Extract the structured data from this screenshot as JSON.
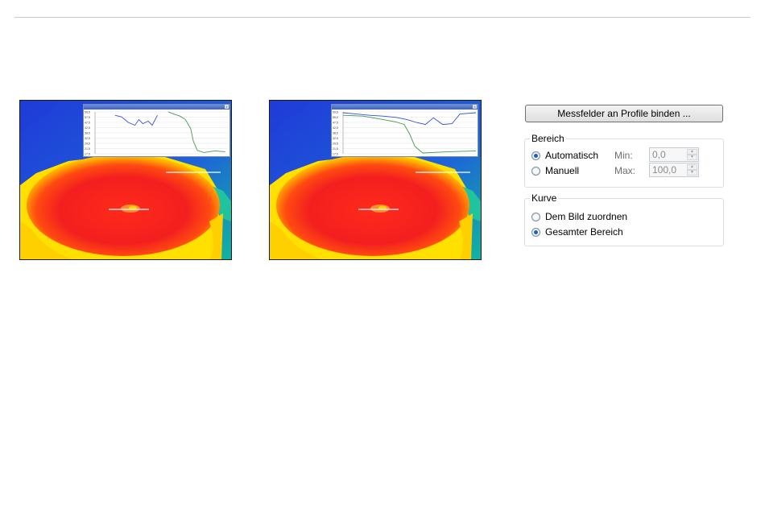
{
  "colors": {
    "thermal_cold": "#1f43d8",
    "thermal_warm": "#ffe600",
    "thermal_hot": "#ee1e1e",
    "profile_blue": "#3a4fd6",
    "profile_green": "#3f9a4e"
  },
  "thermal_images": [
    {
      "popup": {
        "y_ticks": [
          "59,5",
          "57,5",
          "47,5",
          "42,5",
          "38,5",
          "32,5",
          "29,5",
          "21,5",
          "17,5"
        ],
        "curves": {
          "blue": [
            [
              0.15,
              0.08
            ],
            [
              0.2,
              0.12
            ],
            [
              0.25,
              0.25
            ],
            [
              0.3,
              0.32
            ],
            [
              0.33,
              0.18
            ],
            [
              0.36,
              0.28
            ],
            [
              0.4,
              0.22
            ],
            [
              0.43,
              0.32
            ],
            [
              0.47,
              0.08
            ]
          ],
          "green": [
            [
              0.55,
              0.0
            ],
            [
              0.6,
              0.06
            ],
            [
              0.64,
              0.1
            ],
            [
              0.68,
              0.18
            ],
            [
              0.72,
              0.4
            ],
            [
              0.74,
              0.7
            ],
            [
              0.77,
              0.92
            ],
            [
              0.82,
              0.97
            ],
            [
              0.9,
              0.93
            ],
            [
              0.98,
              0.95
            ]
          ]
        }
      }
    },
    {
      "popup": {
        "y_ticks": [
          "59,5",
          "55,5",
          "47,5",
          "42,5",
          "38,5",
          "32,5",
          "29,5",
          "21,5",
          "17,5"
        ],
        "curves": {
          "blue": [
            [
              0.0,
              0.02
            ],
            [
              0.1,
              0.05
            ],
            [
              0.2,
              0.08
            ],
            [
              0.3,
              0.1
            ],
            [
              0.4,
              0.13
            ],
            [
              0.48,
              0.18
            ],
            [
              0.55,
              0.25
            ],
            [
              0.62,
              0.3
            ],
            [
              0.68,
              0.14
            ],
            [
              0.75,
              0.3
            ],
            [
              0.82,
              0.28
            ],
            [
              0.88,
              0.05
            ],
            [
              1.0,
              0.02
            ]
          ],
          "green": [
            [
              0.0,
              0.08
            ],
            [
              0.15,
              0.1
            ],
            [
              0.3,
              0.18
            ],
            [
              0.4,
              0.24
            ],
            [
              0.46,
              0.3
            ],
            [
              0.5,
              0.52
            ],
            [
              0.54,
              0.82
            ],
            [
              0.6,
              0.98
            ],
            [
              0.8,
              0.95
            ],
            [
              1.0,
              0.93
            ]
          ]
        }
      }
    }
  ],
  "controls": {
    "bind_button_label": "Messfelder an Profile binden ...",
    "bereich": {
      "title": "Bereich",
      "automatisch_label": "Automatisch",
      "automatisch_checked": true,
      "manuell_label": "Manuell",
      "manuell_checked": false,
      "min_label": "Min:",
      "min_value": "0,0",
      "max_label": "Max:",
      "max_value": "100,0"
    },
    "kurve": {
      "title": "Kurve",
      "dem_bild_label": "Dem Bild zuordnen",
      "dem_bild_checked": false,
      "gesamter_label": "Gesamter Bereich",
      "gesamter_checked": true
    }
  }
}
